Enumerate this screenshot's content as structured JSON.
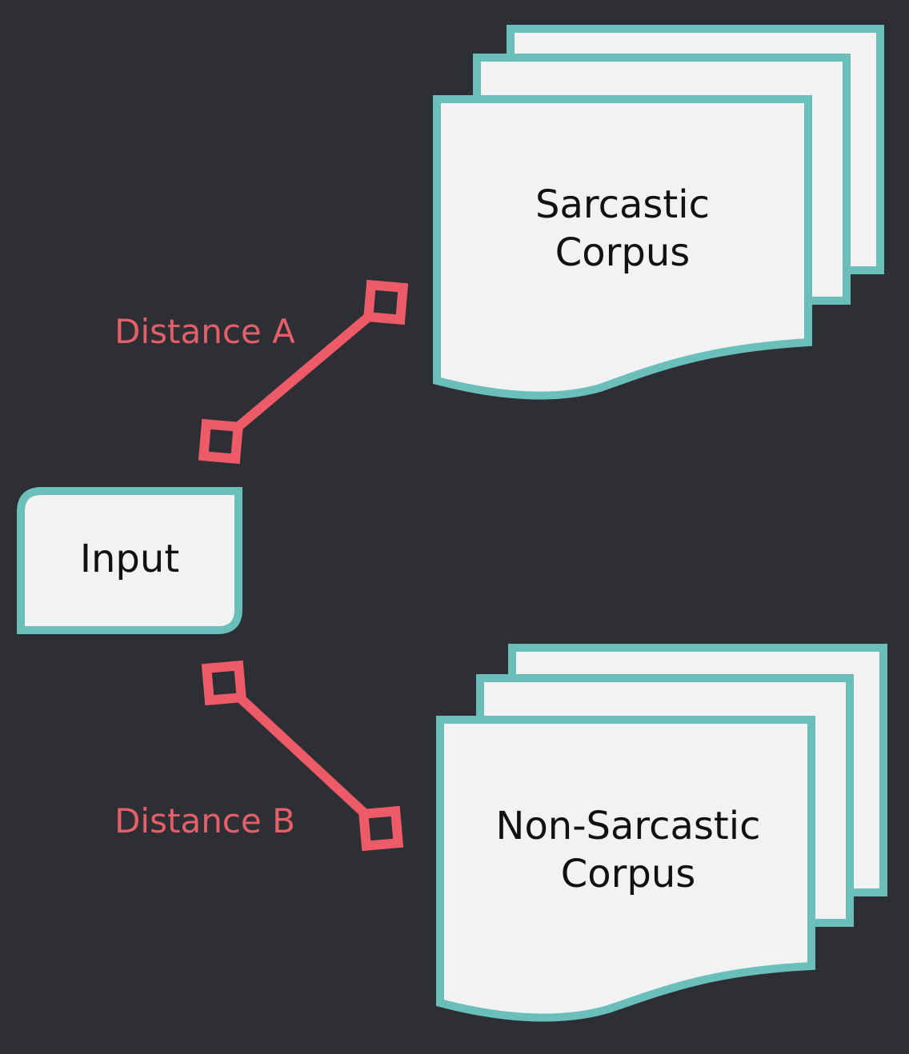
{
  "nodes": {
    "input": {
      "label": "Input"
    },
    "sarcastic": {
      "line1": "Sarcastic",
      "line2": "Corpus"
    },
    "non_sarcastic": {
      "line1": "Non-Sarcastic",
      "line2": "Corpus"
    }
  },
  "connectors": {
    "a": {
      "label": "Distance A"
    },
    "b": {
      "label": "Distance B"
    }
  },
  "colors": {
    "background": "#2e2f34",
    "shape_fill": "#f2f2f2",
    "shape_stroke": "#6bbfba",
    "connector": "#ee5b68",
    "label_text": "#111111"
  }
}
